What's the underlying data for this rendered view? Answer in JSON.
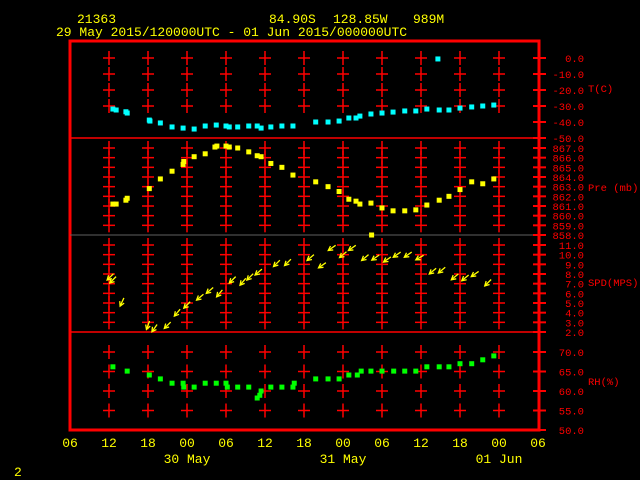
{
  "header": {
    "station": "21363",
    "lat": "84.90S",
    "lon": "128.85W",
    "elev": "989M",
    "range": "29 May 2015/120000UTC - 01 Jun 2015/000000UTC"
  },
  "page_number": "2",
  "colors": {
    "frame": "#ff0000",
    "grid": "#ff0000",
    "text": "#ffff00",
    "temp": "#00ffff",
    "pres": "#ffff00",
    "wind": "#ffff00",
    "rh": "#00ff00",
    "guide": "#606060"
  },
  "chart_data": [
    {
      "type": "scatter",
      "name": "temperature",
      "ylabel": "T(C)",
      "x_units": "hours since 29 May 2015 06 UTC",
      "ticks": [
        "0.0",
        "-10.0",
        "-20.0",
        "-30.0",
        "-40.0",
        "-50.0"
      ],
      "ylim": [
        -50,
        0
      ],
      "points": [
        [
          6.6,
          -31.9
        ],
        [
          7.1,
          -32.5
        ],
        [
          8.6,
          -33.6
        ],
        [
          8.8,
          -34.4
        ],
        [
          12.2,
          -38.8
        ],
        [
          12.3,
          -39.4
        ],
        [
          13.9,
          -40.6
        ],
        [
          15.7,
          -43.1
        ],
        [
          17.4,
          -43.8
        ],
        [
          19.1,
          -44.4
        ],
        [
          20.8,
          -42.5
        ],
        [
          22.5,
          -41.9
        ],
        [
          24.0,
          -42.5
        ],
        [
          24.5,
          -43.1
        ],
        [
          25.8,
          -43.1
        ],
        [
          27.5,
          -42.5
        ],
        [
          28.8,
          -42.5
        ],
        [
          29.4,
          -43.8
        ],
        [
          30.9,
          -43.1
        ],
        [
          32.6,
          -42.5
        ],
        [
          34.3,
          -42.5
        ],
        [
          37.8,
          -40.0
        ],
        [
          39.7,
          -40.0
        ],
        [
          41.4,
          -39.4
        ],
        [
          42.9,
          -37.5
        ],
        [
          44.0,
          -37.5
        ],
        [
          44.6,
          -36.3
        ],
        [
          46.3,
          -35.0
        ],
        [
          48.0,
          -34.4
        ],
        [
          49.7,
          -33.8
        ],
        [
          51.5,
          -33.1
        ],
        [
          53.2,
          -33.1
        ],
        [
          54.9,
          -31.9
        ],
        [
          56.6,
          -0.6
        ],
        [
          56.8,
          -32.5
        ],
        [
          58.3,
          -32.5
        ],
        [
          60.0,
          -31.3
        ],
        [
          61.8,
          -30.6
        ],
        [
          63.5,
          -30.0
        ],
        [
          65.2,
          -29.4
        ]
      ]
    },
    {
      "type": "scatter",
      "name": "pressure",
      "ylabel": "Pre (mb)",
      "ticks": [
        "867.0",
        "866.0",
        "865.0",
        "864.0",
        "863.0",
        "862.0",
        "861.0",
        "860.0",
        "859.0",
        "858.0"
      ],
      "ylim": [
        858,
        867
      ],
      "points": [
        [
          6.6,
          861.2
        ],
        [
          7.1,
          861.2
        ],
        [
          8.6,
          861.6
        ],
        [
          8.8,
          861.8
        ],
        [
          12.2,
          862.8
        ],
        [
          13.9,
          863.8
        ],
        [
          15.7,
          864.6
        ],
        [
          17.4,
          865.3
        ],
        [
          17.5,
          865.6
        ],
        [
          19.1,
          866.1
        ],
        [
          20.8,
          866.4
        ],
        [
          22.3,
          867.1
        ],
        [
          22.6,
          867.2
        ],
        [
          24.0,
          867.2
        ],
        [
          24.5,
          867.1
        ],
        [
          25.8,
          867.0
        ],
        [
          27.5,
          866.6
        ],
        [
          28.8,
          866.2
        ],
        [
          29.4,
          866.1
        ],
        [
          30.9,
          865.4
        ],
        [
          32.6,
          865.0
        ],
        [
          34.3,
          864.2
        ],
        [
          37.8,
          863.5
        ],
        [
          39.7,
          863.0
        ],
        [
          41.4,
          862.5
        ],
        [
          42.9,
          861.7
        ],
        [
          44.0,
          861.5
        ],
        [
          44.6,
          861.2
        ],
        [
          46.3,
          861.3
        ],
        [
          46.4,
          858.0
        ],
        [
          48.0,
          860.8
        ],
        [
          49.7,
          860.5
        ],
        [
          51.5,
          860.5
        ],
        [
          53.2,
          860.6
        ],
        [
          54.9,
          861.1
        ],
        [
          56.8,
          861.6
        ],
        [
          58.3,
          862.0
        ],
        [
          60.0,
          862.7
        ],
        [
          61.8,
          863.5
        ],
        [
          63.5,
          863.3
        ],
        [
          65.2,
          863.8
        ]
      ]
    },
    {
      "type": "scatter",
      "name": "wind",
      "ylabel": "SPD(MPS)",
      "ticks": [
        "11.0",
        "10.0",
        "9.0",
        "8.0",
        "7.0",
        "6.0",
        "5.0",
        "4.0",
        "3.0",
        "2.0"
      ],
      "ylim": [
        2,
        11
      ],
      "points": [
        [
          6.2,
          7.7,
          45
        ],
        [
          6.6,
          7.4,
          45
        ],
        [
          8.0,
          5.1,
          25
        ],
        [
          12.0,
          2.7,
          20
        ],
        [
          13.0,
          2.4,
          35
        ],
        [
          15.0,
          2.7,
          45
        ],
        [
          16.5,
          4.0,
          40
        ],
        [
          18.0,
          4.8,
          45
        ],
        [
          20.0,
          5.6,
          50
        ],
        [
          21.5,
          6.3,
          50
        ],
        [
          23.0,
          6.0,
          40
        ],
        [
          25.0,
          7.4,
          45
        ],
        [
          26.6,
          7.2,
          40
        ],
        [
          27.7,
          7.7,
          45
        ],
        [
          29.0,
          8.2,
          50
        ],
        [
          31.8,
          9.1,
          45
        ],
        [
          33.5,
          9.2,
          45
        ],
        [
          37.0,
          9.7,
          50
        ],
        [
          38.8,
          8.9,
          55
        ],
        [
          40.3,
          10.7,
          55
        ],
        [
          42.0,
          10.0,
          50
        ],
        [
          43.4,
          10.7,
          55
        ],
        [
          45.4,
          9.7,
          50
        ],
        [
          47.0,
          9.7,
          55
        ],
        [
          48.8,
          9.5,
          55
        ],
        [
          50.3,
          10.0,
          55
        ],
        [
          52.0,
          10.0,
          55
        ],
        [
          53.8,
          9.7,
          60
        ],
        [
          55.8,
          8.3,
          50
        ],
        [
          57.2,
          8.4,
          50
        ],
        [
          59.2,
          7.7,
          50
        ],
        [
          60.8,
          7.6,
          50
        ],
        [
          62.3,
          8.0,
          55
        ],
        [
          64.3,
          7.1,
          45
        ]
      ]
    },
    {
      "type": "scatter",
      "name": "relative_humidity",
      "ylabel": "RH(%)",
      "ticks": [
        "70.0",
        "65.0",
        "60.0",
        "55.0",
        "50.0"
      ],
      "ylim": [
        50,
        70
      ],
      "points": [
        [
          6.6,
          66.2
        ],
        [
          8.8,
          65.1
        ],
        [
          12.2,
          64.1
        ],
        [
          13.9,
          63.1
        ],
        [
          15.7,
          62.0
        ],
        [
          17.4,
          62.0
        ],
        [
          17.5,
          61.0
        ],
        [
          19.1,
          61.0
        ],
        [
          20.8,
          62.0
        ],
        [
          22.5,
          62.0
        ],
        [
          24.0,
          62.0
        ],
        [
          24.2,
          61.0
        ],
        [
          25.8,
          61.0
        ],
        [
          27.5,
          61.0
        ],
        [
          29.4,
          60.0
        ],
        [
          29.2,
          58.9
        ],
        [
          28.8,
          58.2
        ],
        [
          30.9,
          61.0
        ],
        [
          32.6,
          61.0
        ],
        [
          34.3,
          61.0
        ],
        [
          34.5,
          62.0
        ],
        [
          37.8,
          63.1
        ],
        [
          39.7,
          63.1
        ],
        [
          41.4,
          63.1
        ],
        [
          42.9,
          64.1
        ],
        [
          44.2,
          64.1
        ],
        [
          44.8,
          65.1
        ],
        [
          46.3,
          65.1
        ],
        [
          48.0,
          65.1
        ],
        [
          49.8,
          65.1
        ],
        [
          51.5,
          65.1
        ],
        [
          53.2,
          65.1
        ],
        [
          54.9,
          66.2
        ],
        [
          56.8,
          66.2
        ],
        [
          58.3,
          66.2
        ],
        [
          60.0,
          67.0
        ],
        [
          61.8,
          67.0
        ],
        [
          63.5,
          68.0
        ],
        [
          65.2,
          69.0
        ]
      ]
    }
  ],
  "x_axis": {
    "ticks": [
      "06",
      "12",
      "18",
      "00",
      "06",
      "12",
      "18",
      "00",
      "06",
      "12",
      "18",
      "00",
      "06"
    ],
    "dates": [
      {
        "label": "30 May",
        "hour": 18
      },
      {
        "label": "31 May",
        "hour": 42
      },
      {
        "label": "01 Jun",
        "hour": 66
      }
    ]
  }
}
